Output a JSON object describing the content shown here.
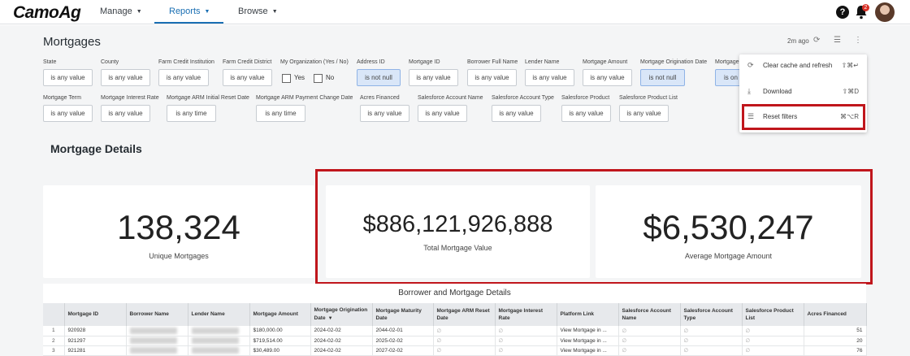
{
  "app": {
    "logo": "CamoAg"
  },
  "nav": [
    {
      "label": "Manage"
    },
    {
      "label": "Reports"
    },
    {
      "label": "Browse"
    }
  ],
  "header": {
    "notification_count": "2",
    "help": "?"
  },
  "page": {
    "title": "Mortgages",
    "updated": "2m ago"
  },
  "filters": [
    {
      "label": "State",
      "value": "is any value"
    },
    {
      "label": "County",
      "value": "is any value"
    },
    {
      "label": "Farm Credit Institution",
      "value": "is any value"
    },
    {
      "label": "Farm Credit District",
      "value": "is any value"
    },
    {
      "label": "My Organization (Yes / No)",
      "opt_yes": "Yes",
      "opt_no": "No"
    },
    {
      "label": "Address ID",
      "value": "is not null"
    },
    {
      "label": "Mortgage ID",
      "value": "is any value"
    },
    {
      "label": "Borrower Full Name",
      "value": "is any value"
    },
    {
      "label": "Lender Name",
      "value": "is any value"
    },
    {
      "label": "Mortgage Amount",
      "value": "is any value"
    },
    {
      "label": "Mortgage Origination Date",
      "value": "is not null"
    },
    {
      "label": "Mortgage",
      "value": "is on o"
    },
    {
      "label": "Mortgage Term",
      "value": "is any value"
    },
    {
      "label": "Mortgage Interest Rate",
      "value": "is any value"
    },
    {
      "label": "Mortgage ARM Initial Reset Date",
      "value": "is any time"
    },
    {
      "label": "Mortgage ARM Payment Change Date",
      "value": "is any time"
    },
    {
      "label": "Acres Financed",
      "value": "is any value"
    },
    {
      "label": "Salesforce Account Name",
      "value": "is any value"
    },
    {
      "label": "Salesforce Account Type",
      "value": "is any value"
    },
    {
      "label": "Salesforce Product",
      "value": "is any value"
    },
    {
      "label": "Salesforce Product List",
      "value": "is any value"
    }
  ],
  "menu": [
    {
      "label": "Clear cache and refresh",
      "shortcut": "⇧⌘↵",
      "icon": "refresh-icon"
    },
    {
      "label": "Download",
      "shortcut": "⇧⌘D",
      "icon": "download-icon"
    },
    {
      "label": "Reset filters",
      "shortcut": "⌘⌥R",
      "icon": "filter-lines-icon"
    }
  ],
  "section": {
    "title": "Mortgage Details"
  },
  "kpis": [
    {
      "value": "138,324",
      "label": "Unique Mortgages"
    },
    {
      "value": "$886,121,926,888",
      "label": "Total Mortgage Value"
    },
    {
      "value": "$6,530,247",
      "label": "Average Mortgage Amount"
    }
  ],
  "table": {
    "title": "Borrower and Mortgage Details",
    "columns": [
      "",
      "Mortgage ID",
      "Borrower Name",
      "Lender Name",
      "Mortgage Amount",
      "Mortgage Origination Date",
      "Mortgage Maturity Date",
      "Mortgage ARM Reset Date",
      "Mortgage Interest Rate",
      "Platform Link",
      "Salesforce Account Name",
      "Salesforce Account Type",
      "Salesforce Product List",
      "Acres Financed"
    ],
    "rows": [
      [
        "1",
        "920928",
        "",
        "",
        "$180,000.00",
        "2024-02-02",
        "2044-02-01",
        "∅",
        "∅",
        "View Mortgage in ...",
        "∅",
        "∅",
        "∅",
        "51"
      ],
      [
        "2",
        "921297",
        "",
        "",
        "$719,514.00",
        "2024-02-02",
        "2025-02-02",
        "∅",
        "∅",
        "View Mortgage in ...",
        "∅",
        "∅",
        "∅",
        "20"
      ],
      [
        "3",
        "921281",
        "",
        "",
        "$30,489.00",
        "2024-02-02",
        "2027-02-02",
        "∅",
        "∅",
        "View Mortgage in ...",
        "∅",
        "∅",
        "∅",
        "76"
      ]
    ]
  },
  "colors": {
    "accent": "#1a6fb3",
    "highlight": "#c0161c",
    "badge": "#d93025"
  }
}
